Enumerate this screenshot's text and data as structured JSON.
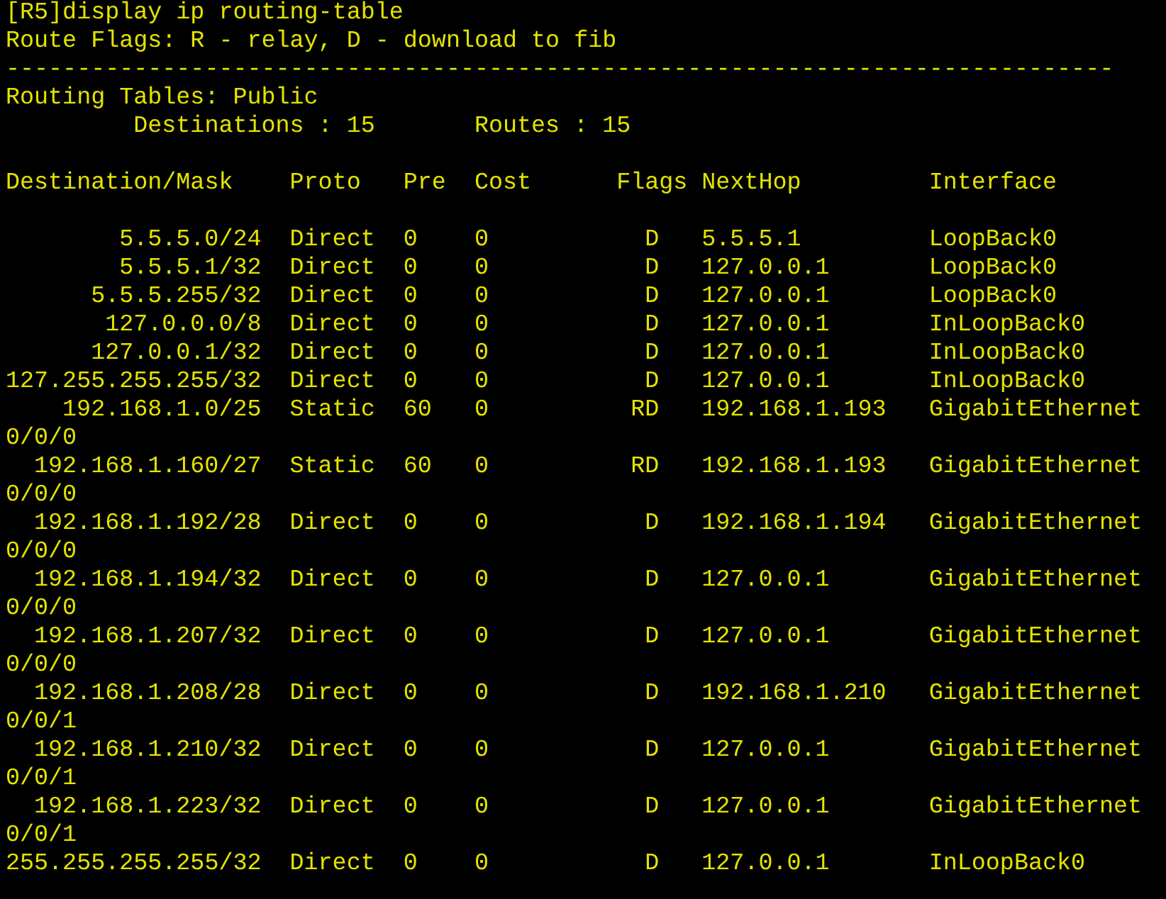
{
  "command": "[R5]display ip routing-table",
  "legend": "Route Flags: R - relay, D - download to fib",
  "separator": "------------------------------------------------------------------------------",
  "table_title": "Routing Tables: Public",
  "summary": {
    "destinations": "Destinations : 15",
    "routes": "Routes : 15"
  },
  "columns": [
    "Destination/Mask",
    "Proto",
    "Pre",
    "Cost",
    "Flags",
    "NextHop",
    "Interface"
  ],
  "rows": [
    {
      "destination": "5.5.5.0/24",
      "proto": "Direct",
      "pre": "0",
      "cost": "0",
      "flags": "D",
      "nexthop": "5.5.5.1",
      "interface": "LoopBack0"
    },
    {
      "destination": "5.5.5.1/32",
      "proto": "Direct",
      "pre": "0",
      "cost": "0",
      "flags": "D",
      "nexthop": "127.0.0.1",
      "interface": "LoopBack0"
    },
    {
      "destination": "5.5.5.255/32",
      "proto": "Direct",
      "pre": "0",
      "cost": "0",
      "flags": "D",
      "nexthop": "127.0.0.1",
      "interface": "LoopBack0"
    },
    {
      "destination": "127.0.0.0/8",
      "proto": "Direct",
      "pre": "0",
      "cost": "0",
      "flags": "D",
      "nexthop": "127.0.0.1",
      "interface": "InLoopBack0"
    },
    {
      "destination": "127.0.0.1/32",
      "proto": "Direct",
      "pre": "0",
      "cost": "0",
      "flags": "D",
      "nexthop": "127.0.0.1",
      "interface": "InLoopBack0"
    },
    {
      "destination": "127.255.255.255/32",
      "proto": "Direct",
      "pre": "0",
      "cost": "0",
      "flags": "D",
      "nexthop": "127.0.0.1",
      "interface": "InLoopBack0"
    },
    {
      "destination": "192.168.1.0/25",
      "proto": "Static",
      "pre": "60",
      "cost": "0",
      "flags": "RD",
      "nexthop": "192.168.1.193",
      "interface": "GigabitEthernet",
      "interface_wrap": "0/0/0"
    },
    {
      "destination": "192.168.1.160/27",
      "proto": "Static",
      "pre": "60",
      "cost": "0",
      "flags": "RD",
      "nexthop": "192.168.1.193",
      "interface": "GigabitEthernet",
      "interface_wrap": "0/0/0"
    },
    {
      "destination": "192.168.1.192/28",
      "proto": "Direct",
      "pre": "0",
      "cost": "0",
      "flags": "D",
      "nexthop": "192.168.1.194",
      "interface": "GigabitEthernet",
      "interface_wrap": "0/0/0"
    },
    {
      "destination": "192.168.1.194/32",
      "proto": "Direct",
      "pre": "0",
      "cost": "0",
      "flags": "D",
      "nexthop": "127.0.0.1",
      "interface": "GigabitEthernet",
      "interface_wrap": "0/0/0"
    },
    {
      "destination": "192.168.1.207/32",
      "proto": "Direct",
      "pre": "0",
      "cost": "0",
      "flags": "D",
      "nexthop": "127.0.0.1",
      "interface": "GigabitEthernet",
      "interface_wrap": "0/0/0"
    },
    {
      "destination": "192.168.1.208/28",
      "proto": "Direct",
      "pre": "0",
      "cost": "0",
      "flags": "D",
      "nexthop": "192.168.1.210",
      "interface": "GigabitEthernet",
      "interface_wrap": "0/0/1"
    },
    {
      "destination": "192.168.1.210/32",
      "proto": "Direct",
      "pre": "0",
      "cost": "0",
      "flags": "D",
      "nexthop": "127.0.0.1",
      "interface": "GigabitEthernet",
      "interface_wrap": "0/0/1"
    },
    {
      "destination": "192.168.1.223/32",
      "proto": "Direct",
      "pre": "0",
      "cost": "0",
      "flags": "D",
      "nexthop": "127.0.0.1",
      "interface": "GigabitEthernet",
      "interface_wrap": "0/0/1"
    },
    {
      "destination": "255.255.255.255/32",
      "proto": "Direct",
      "pre": "0",
      "cost": "0",
      "flags": "D",
      "nexthop": "127.0.0.1",
      "interface": "InLoopBack0"
    }
  ]
}
